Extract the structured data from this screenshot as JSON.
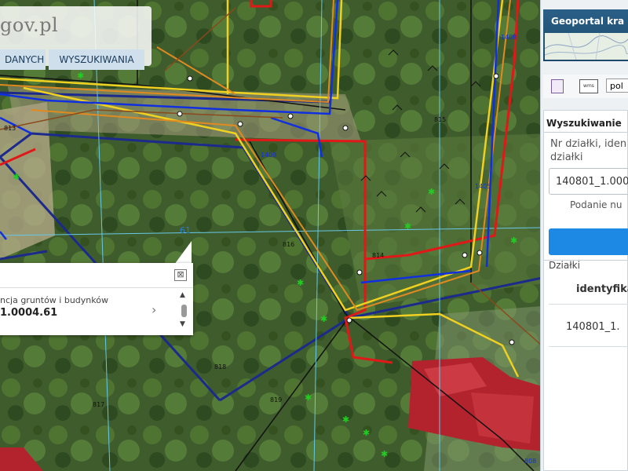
{
  "header": {
    "logo_text": "gov.pl",
    "tabs": [
      "DANYCH",
      "WYSZUKIWANIA"
    ]
  },
  "popup": {
    "line1": "ncja gruntów i budynków",
    "line2": "1.0004.61",
    "close_glyph": "⊠"
  },
  "map": {
    "labels": {
      "parcel_61": "61",
      "n814": "814",
      "n815": "815",
      "n816": "816",
      "n813": "813",
      "n817": "817",
      "n818": "818",
      "n819": "819",
      "n1408": "1408",
      "n1405": "1405",
      "n1409": "1409",
      "n808": "808"
    }
  },
  "geoportal": {
    "title": "Geoportal kra"
  },
  "toolbar": {
    "icon2_text": "wms",
    "input_value": "pol"
  },
  "search": {
    "title": "Wyszukiwanie",
    "label": "Nr działki, iden działki",
    "input_value": "140801_1.000",
    "hint": "Podanie nu",
    "results_heading": "Działki",
    "column_header": "identyfika",
    "row_value": "140801_1."
  },
  "colors": {
    "parcel_boundary": "#1c2a8c",
    "utility_red": "#e01818",
    "utility_yellow": "#f0d020",
    "utility_orange": "#e08a20",
    "utility_blue": "#1030e0",
    "roof_red": "#b0202a",
    "panel_blue": "#1e88e5"
  }
}
